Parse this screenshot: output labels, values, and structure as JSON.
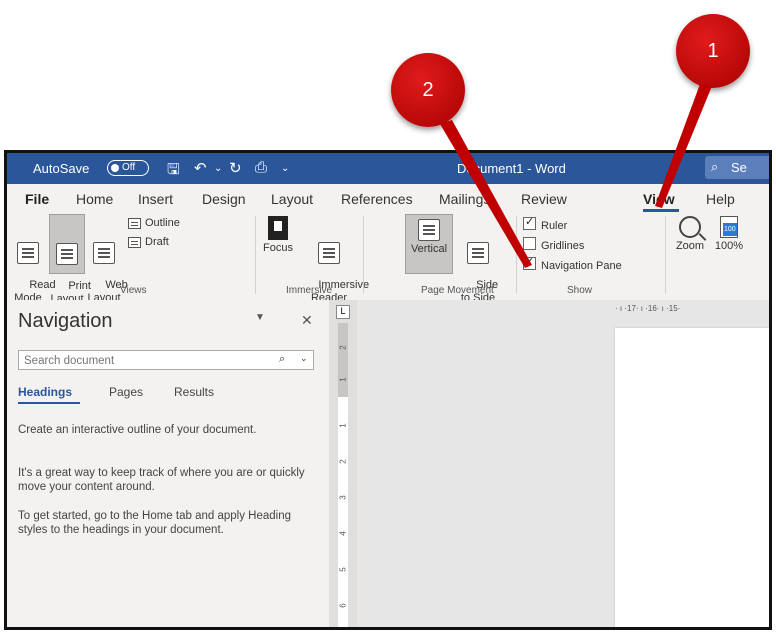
{
  "titlebar": {
    "autosave_label": "AutoSave",
    "autosave_state": "Off",
    "document_title": "Document1 - Word",
    "search_placeholder": "Se"
  },
  "tabs": [
    {
      "label": "File"
    },
    {
      "label": "Home"
    },
    {
      "label": "Insert"
    },
    {
      "label": "Design"
    },
    {
      "label": "Layout"
    },
    {
      "label": "References"
    },
    {
      "label": "Mailings"
    },
    {
      "label": "Review"
    },
    {
      "label": "View"
    },
    {
      "label": "Help"
    }
  ],
  "ribbon": {
    "views": {
      "read_mode": "Read\nMode",
      "print_layout": "Print\nLayout",
      "web_layout": "Web\nLayout",
      "outline": "Outline",
      "draft": "Draft",
      "group_label": "Views"
    },
    "immersive": {
      "focus": "Focus",
      "immersive_reader": "Immersive\nReader",
      "group_label": "Immersive"
    },
    "page_movement": {
      "vertical": "Vertical",
      "side_to_side": "Side\nto Side",
      "group_label": "Page Movement"
    },
    "show": {
      "ruler": "Ruler",
      "gridlines": "Gridlines",
      "navigation_pane": "Navigation Pane",
      "group_label": "Show"
    },
    "zoom": {
      "zoom": "Zoom",
      "hundred": "100%",
      "hundred_icon_text": "100"
    }
  },
  "navigation": {
    "title": "Navigation",
    "search_placeholder": "Search document",
    "tabs": [
      "Headings",
      "Pages",
      "Results"
    ],
    "paragraphs": [
      "Create an interactive outline of your document.",
      "It's a great way to keep track of where you are or quickly move your content around.",
      "To get started, go to the Home tab and apply Heading styles to the headings in your document."
    ]
  },
  "rulers": {
    "horizontal": "· ı ·17· ı ·16· ı ·15·",
    "vertical_marks": [
      "2",
      "1",
      "1",
      "2",
      "3",
      "4",
      "5",
      "6"
    ],
    "corner_glyph": "L"
  },
  "callouts": [
    "1",
    "2"
  ],
  "colors": {
    "titlebar": "#2b579a",
    "callout": "#c00000"
  }
}
